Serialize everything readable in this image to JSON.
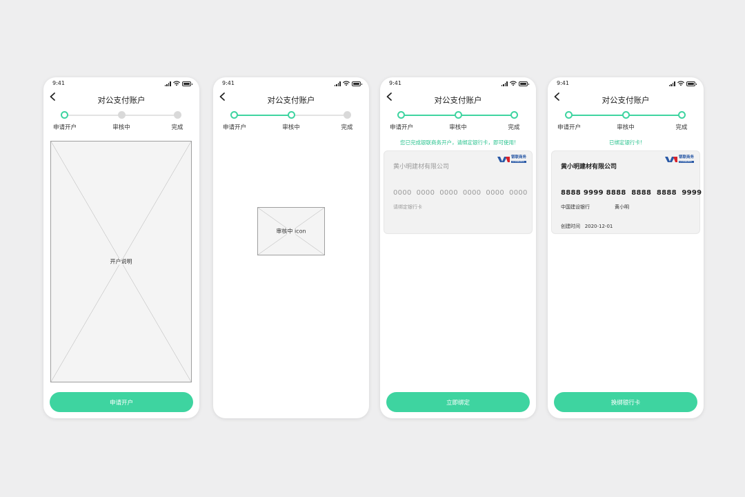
{
  "status_time": "9:41",
  "nav_title": "对公支付账户",
  "steps": [
    "申请开户",
    "审核中",
    "完成"
  ],
  "colors": {
    "accent": "#3ed4a0",
    "background": "#eeeeef",
    "notice": "#27c28d"
  },
  "screen1": {
    "progress_step": 1,
    "placeholder_label": "开户说明",
    "button_label": "申请开户"
  },
  "screen2": {
    "progress_step": 2,
    "placeholder_label": "审核中 icon"
  },
  "screen3": {
    "progress_step": 3,
    "notice": "您已完成银联商务开户，请绑定银行卡，即可使用!",
    "card": {
      "company": "黄小明建材有限公司",
      "number": "0000  0000  0000  0000  0000  0000",
      "hint": "请绑定银行卡"
    },
    "button_label": "立即绑定"
  },
  "screen4": {
    "progress_step": 3,
    "notice": "已绑定银行卡!",
    "card": {
      "company": "黄小明建材有限公司",
      "number": "8888 9999 8888  8888  8888  9999",
      "bank": "中国建设银行",
      "holder": "黄小明",
      "created_label": "创建时间",
      "created_date": "2020-12-01"
    },
    "button_label": "换绑银行卡"
  },
  "logo": {
    "name": "银联商务",
    "sub": "ChinaUMS"
  }
}
